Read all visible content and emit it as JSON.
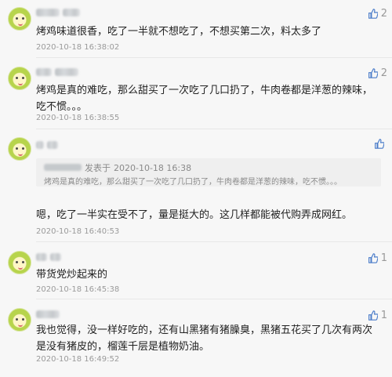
{
  "comments": [
    {
      "likes": "2",
      "text": "烤鸡味道很香，吃了一半就不想吃了，不想买第二次，料太多了",
      "time": "2020-10-18 16:38:02"
    },
    {
      "likes": "2",
      "text": "烤鸡是真的难吃，那么甜买了一次吃了几口扔了，牛肉卷都是洋葱的辣味，吃不惯。。。",
      "time": "2020-10-18 16:38:55"
    },
    {
      "likes": "",
      "quote_prefix": "发表于",
      "quote_time": "2020-10-18 16:38",
      "quote_text": "烤鸡是真的难吃，那么甜买了一次吃了几口扔了，牛肉卷都是洋葱的辣味，吃不惯。。。",
      "text": "嗯，吃了一半实在受不了，量是挺大的。这几样都能被代购弄成网红。",
      "time": "2020-10-18 16:40:53"
    },
    {
      "likes": "1",
      "text": "带货党炒起来的",
      "time": "2020-10-18 16:45:38"
    },
    {
      "likes": "1",
      "text": "我也觉得，没一样好吃的，还有山黑猪有猪臊臭，黑猪五花买了几次有两次是没有猪皮的，榴莲千层是植物奶油。",
      "time": "2020-10-18 16:49:52"
    }
  ],
  "icons": {
    "like": "thumbs-up-icon",
    "avatar": "cartoon-face-avatar"
  },
  "colors": {
    "like_icon": "#4a7cc9",
    "time": "#9a9a9a"
  }
}
